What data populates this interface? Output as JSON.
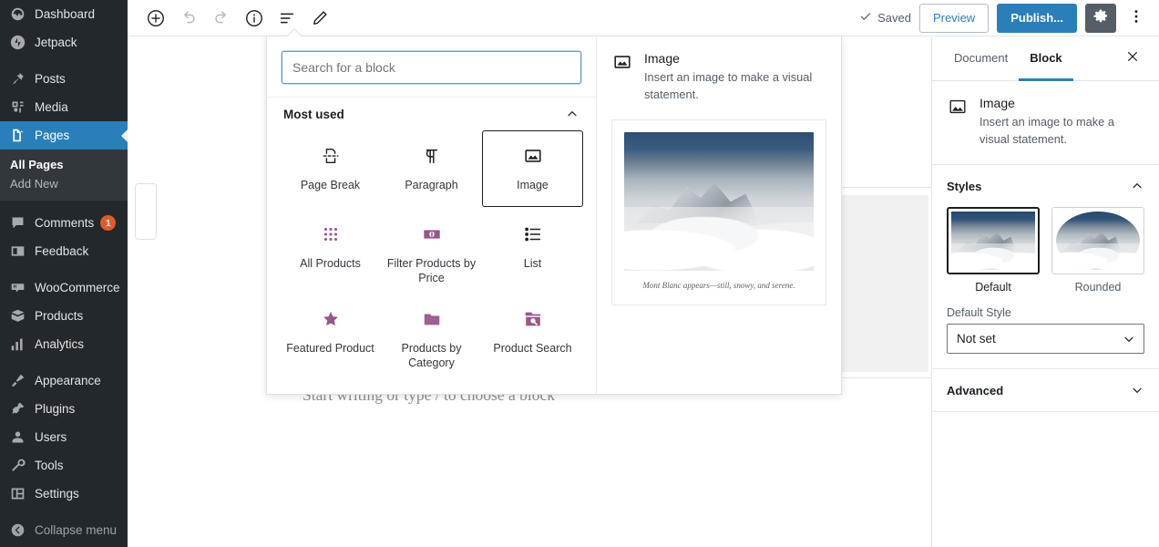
{
  "admin_sidebar": {
    "items": [
      {
        "label": "Dashboard",
        "icon": "dashboard-icon",
        "active": false
      },
      {
        "label": "Jetpack",
        "icon": "jetpack-icon",
        "active": false
      },
      {
        "label": "Posts",
        "icon": "pin-icon",
        "active": false
      },
      {
        "label": "Media",
        "icon": "media-icon",
        "active": false
      },
      {
        "label": "Pages",
        "icon": "pages-icon",
        "active": true
      },
      {
        "label": "Comments",
        "icon": "comments-icon",
        "badge": "1",
        "active": false
      },
      {
        "label": "Feedback",
        "icon": "feedback-icon",
        "active": false
      },
      {
        "label": "WooCommerce",
        "icon": "woocommerce-icon",
        "active": false
      },
      {
        "label": "Products",
        "icon": "products-icon",
        "active": false
      },
      {
        "label": "Analytics",
        "icon": "analytics-icon",
        "active": false
      },
      {
        "label": "Appearance",
        "icon": "appearance-icon",
        "active": false
      },
      {
        "label": "Plugins",
        "icon": "plugins-icon",
        "active": false
      },
      {
        "label": "Users",
        "icon": "users-icon",
        "active": false
      },
      {
        "label": "Tools",
        "icon": "tools-icon",
        "active": false
      },
      {
        "label": "Settings",
        "icon": "settings-icon",
        "active": false
      },
      {
        "label": "Collapse menu",
        "icon": "collapse-icon",
        "active": false
      }
    ],
    "pages_submenu": [
      {
        "label": "All Pages",
        "current": true
      },
      {
        "label": "Add New",
        "current": false
      }
    ],
    "active_color": "#2a7fbb",
    "badge_color": "#e05a2b"
  },
  "toolbar": {
    "left_buttons": [
      {
        "name": "add-block-button",
        "icon": "plus-circle-icon"
      },
      {
        "name": "undo-button",
        "icon": "undo-icon"
      },
      {
        "name": "redo-button",
        "icon": "redo-icon"
      },
      {
        "name": "info-button",
        "icon": "info-circle-icon"
      },
      {
        "name": "list-view-button",
        "icon": "list-view-icon"
      },
      {
        "name": "edit-button",
        "icon": "pencil-icon"
      }
    ],
    "saved_label": "Saved",
    "preview_label": "Preview",
    "publish_label": "Publish...",
    "settings_icon": "gear-icon",
    "more_icon": "kebab-menu-icon",
    "publish_color": "#2a7fbb"
  },
  "canvas": {
    "prompt": "Start writing or type / to choose a block"
  },
  "inserter": {
    "search": {
      "placeholder": "Search for a block",
      "value": ""
    },
    "section_title": "Most used",
    "section_collapse_icon": "chevron-up-icon",
    "blocks": [
      {
        "label": "Page Break",
        "icon": "page-break-icon",
        "selected": false,
        "woo": false
      },
      {
        "label": "Paragraph",
        "icon": "paragraph-icon",
        "selected": false,
        "woo": false
      },
      {
        "label": "Image",
        "icon": "image-icon",
        "selected": true,
        "woo": false
      },
      {
        "label": "All Products",
        "icon": "grid-dots-icon",
        "selected": false,
        "woo": true
      },
      {
        "label": "Filter Products by Price",
        "icon": "price-filter-icon",
        "selected": false,
        "woo": true
      },
      {
        "label": "List",
        "icon": "list-icon",
        "selected": false,
        "woo": false
      },
      {
        "label": "Featured Product",
        "icon": "star-icon",
        "selected": false,
        "woo": true
      },
      {
        "label": "Products by Category",
        "icon": "folder-icon",
        "selected": false,
        "woo": true
      },
      {
        "label": "Product Search",
        "icon": "folder-search-icon",
        "selected": false,
        "woo": true
      }
    ],
    "preview": {
      "icon": "image-icon",
      "title": "Image",
      "description": "Insert an image to make a visual statement.",
      "caption": "Mont Blanc appears—still, snowy, and serene."
    }
  },
  "settings_sidebar": {
    "tabs": [
      {
        "label": "Document",
        "active": false
      },
      {
        "label": "Block",
        "active": true
      }
    ],
    "close_icon": "close-icon",
    "block_info": {
      "icon": "image-icon",
      "title": "Image",
      "description": "Insert an image to make a visual statement."
    },
    "styles_panel": {
      "title": "Styles",
      "collapse_icon": "chevron-up-icon",
      "options": [
        {
          "name": "Default",
          "selected": true,
          "shape": "rect"
        },
        {
          "name": "Rounded",
          "selected": false,
          "shape": "circle"
        }
      ],
      "field_label": "Default Style",
      "select_value": "Not set",
      "select_icon": "chevron-down-icon"
    },
    "advanced_panel": {
      "title": "Advanced",
      "collapse_icon": "chevron-down-icon"
    },
    "accent_color": "#2a7fbb"
  }
}
